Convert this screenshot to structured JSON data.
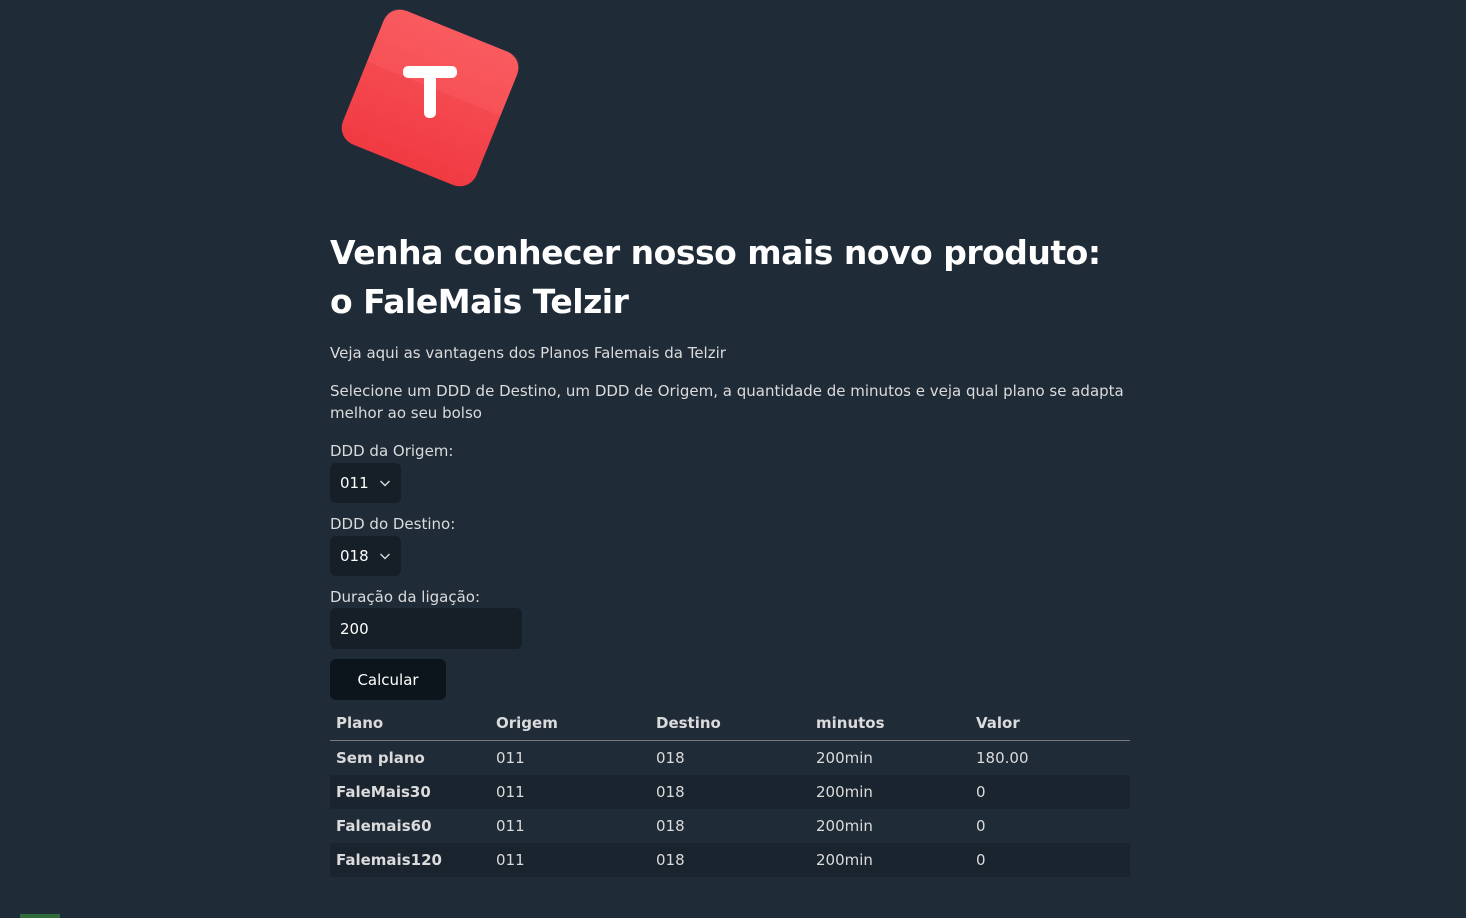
{
  "brand": {
    "logo_letter": "T",
    "logo_color": "#f2434a",
    "logo_icon": "telzir-logo"
  },
  "header": {
    "title": "Venha conhecer nosso mais novo produto: o FaleMais Telzir"
  },
  "intro": {
    "line1": "Veja aqui as vantagens dos Planos Falemais da Telzir",
    "line2": "Selecione um DDD de Destino, um DDD de Origem, a quantidade de minutos e veja qual plano se adapta melhor ao seu bolso"
  },
  "form": {
    "origin_label": "DDD da Origem:",
    "origin_value": "011",
    "dest_label": "DDD do Destino:",
    "dest_value": "018",
    "duration_label": "Duração da ligação:",
    "duration_value": "200",
    "submit_label": "Calcular"
  },
  "table": {
    "headers": [
      "Plano",
      "Origem",
      "Destino",
      "minutos",
      "Valor"
    ],
    "rows": [
      [
        "Sem plano",
        "011",
        "018",
        "200min",
        "180.00"
      ],
      [
        "FaleMais30",
        "011",
        "018",
        "200min",
        "0"
      ],
      [
        "Falemais60",
        "011",
        "018",
        "200min",
        "0"
      ],
      [
        "Falemais120",
        "011",
        "018",
        "200min",
        "0"
      ]
    ]
  },
  "colors": {
    "background": "#202b38",
    "control_bg": "#161f27",
    "button_bg": "#0c151c"
  }
}
